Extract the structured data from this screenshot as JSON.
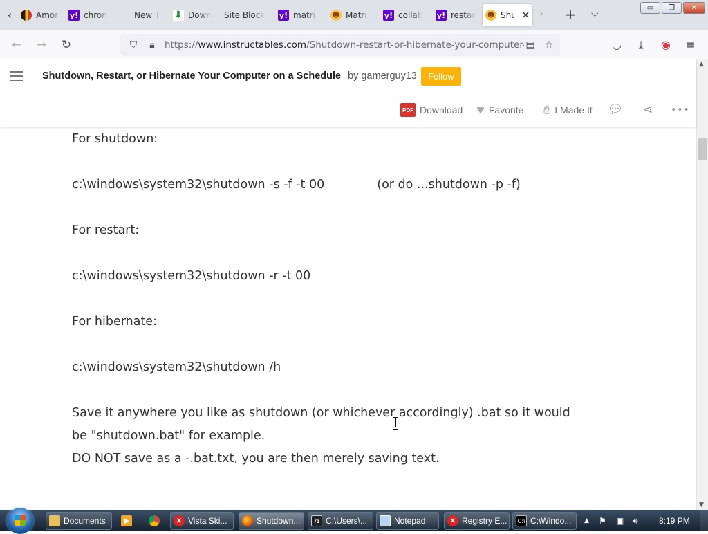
{
  "browser": {
    "tabs": [
      {
        "label": "Amor",
        "favicon": "amor-icon",
        "active": false
      },
      {
        "label": "chron",
        "favicon": "yahoo-icon",
        "active": false
      },
      {
        "label": "New T",
        "favicon": "",
        "active": false
      },
      {
        "label": "Down",
        "favicon": "download-icon",
        "active": false
      },
      {
        "label": "Site Blocke",
        "favicon": "",
        "active": false
      },
      {
        "label": "matri",
        "favicon": "yahoo-icon",
        "active": false
      },
      {
        "label": "Matri",
        "favicon": "instructables-icon",
        "active": false
      },
      {
        "label": "collab",
        "favicon": "yahoo-icon",
        "active": false
      },
      {
        "label": "restar",
        "favicon": "yahoo-icon",
        "active": false
      },
      {
        "label": "Shu",
        "favicon": "instructables-icon",
        "active": true
      }
    ],
    "new_tab_glyph": "+",
    "tab_close_glyph": "✕",
    "url": {
      "scheme": "https://",
      "host": "www.instructables.com",
      "path": "/Shutdown-restart-or-hibernate-your-computer-on-a/"
    },
    "window_buttons": {
      "minimize": "▭",
      "maximize": "❐",
      "close": "✕"
    }
  },
  "site": {
    "title": "Shutdown, Restart, or Hibernate Your Computer on a Schedule",
    "by_prefix": "by",
    "author": "gamerguy13",
    "follow_label": "Follow",
    "actions": {
      "download": "Download",
      "favorite": "Favorite",
      "made_it": "I Made It"
    },
    "accent_color": "#fab306"
  },
  "content": {
    "paragraphs": [
      {
        "text": "For shutdown:"
      },
      {
        "text": "c:\\windows\\system32\\shutdown -s -f -t 00",
        "note": "(or do ...shutdown -p -f)"
      },
      {
        "text": "For restart:"
      },
      {
        "text": "c:\\windows\\system32\\shutdown -r -t 00"
      },
      {
        "text": "For hibernate:"
      },
      {
        "text": "c:\\windows\\system32\\shutdown /h"
      },
      {
        "text": "Save it anywhere you like as shutdown (or whichever accordingly) .bat so it would"
      },
      {
        "text": "be \"shutdown.bat\" for example."
      },
      {
        "text": "DO NOT save as a -.bat.txt, you are then merely saving text."
      }
    ]
  },
  "taskbar": {
    "items": [
      {
        "label": "Documents",
        "icon": "folder-icon",
        "active": false
      },
      {
        "label": "",
        "icon": "media-player-icon",
        "active": false
      },
      {
        "label": "",
        "icon": "chrome-icon",
        "active": false
      },
      {
        "label": "Vista Ski...",
        "icon": "error-icon",
        "active": false
      },
      {
        "label": "Shutdown...",
        "icon": "firefox-icon",
        "active": true
      },
      {
        "label": "C:\\Users\\...",
        "icon": "7zip-icon",
        "active": false
      },
      {
        "label": "Notepad",
        "icon": "notepad-icon",
        "active": false
      },
      {
        "label": "Registry E...",
        "icon": "error-icon",
        "active": false
      },
      {
        "label": "C:\\Windo...",
        "icon": "cmd-icon",
        "active": false
      }
    ],
    "clock": "8:19 PM"
  }
}
